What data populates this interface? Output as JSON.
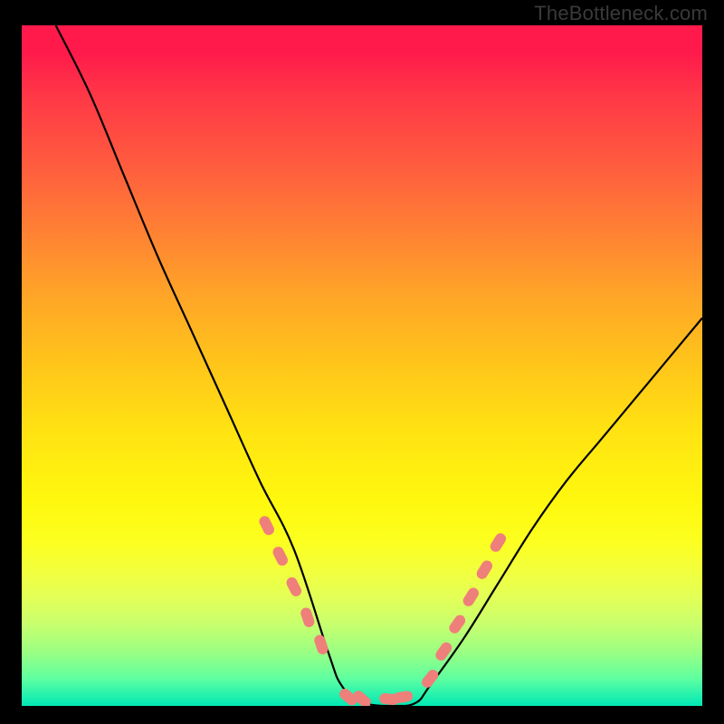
{
  "attribution": "TheBottleneck.com",
  "chart_data": {
    "type": "line",
    "title": "",
    "xlabel": "",
    "ylabel": "",
    "xlim": [
      0,
      100
    ],
    "ylim": [
      0,
      100
    ],
    "background_gradient": {
      "top": "#ff1a4b",
      "bottom": "#00e8b5",
      "note": "vertical red→orange→yellow→green gradient"
    },
    "series": [
      {
        "name": "curve",
        "stroke": "#000000",
        "x": [
          5,
          10,
          15,
          20,
          25,
          30,
          35,
          40,
          45,
          47,
          50,
          55,
          58,
          60,
          65,
          70,
          75,
          80,
          85,
          90,
          95,
          100
        ],
        "y": [
          100,
          90,
          78,
          66,
          55,
          44,
          33,
          23,
          8,
          3,
          0.5,
          0,
          0.5,
          3,
          10,
          18,
          26,
          33,
          39,
          45,
          51,
          57
        ]
      }
    ],
    "markers": {
      "name": "salmon-markers",
      "fill": "#ef7f7a",
      "shape": "rounded-capsule",
      "points": [
        {
          "x": 36.0,
          "y": 26.5
        },
        {
          "x": 38.0,
          "y": 22.0
        },
        {
          "x": 40.0,
          "y": 17.5
        },
        {
          "x": 42.0,
          "y": 13.0
        },
        {
          "x": 44.0,
          "y": 9.0
        },
        {
          "x": 48.0,
          "y": 1.3
        },
        {
          "x": 50.0,
          "y": 1.0
        },
        {
          "x": 54.0,
          "y": 1.0
        },
        {
          "x": 56.0,
          "y": 1.3
        },
        {
          "x": 60.0,
          "y": 4.0
        },
        {
          "x": 62.0,
          "y": 8.0
        },
        {
          "x": 64.0,
          "y": 12.0
        },
        {
          "x": 66.0,
          "y": 16.0
        },
        {
          "x": 68.0,
          "y": 20.0
        },
        {
          "x": 70.0,
          "y": 24.0
        }
      ]
    }
  }
}
